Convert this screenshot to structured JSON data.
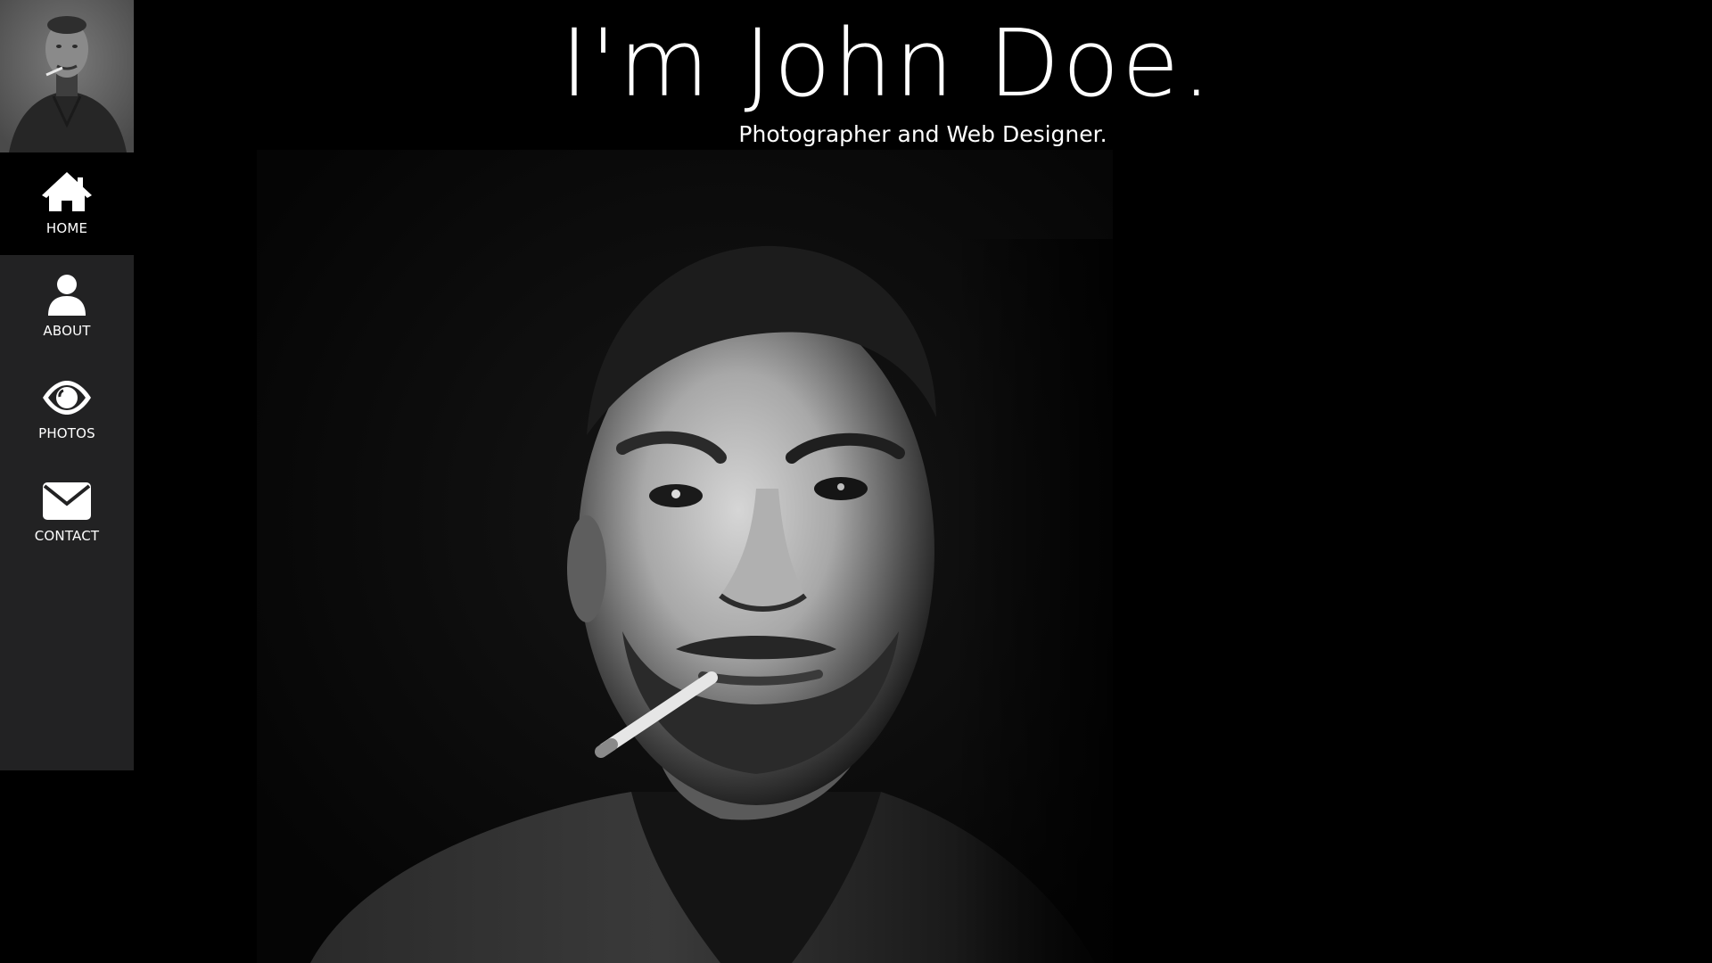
{
  "hero": {
    "title": "I'm John Doe.",
    "subtitle": "Photographer and Web Designer."
  },
  "sidebar": {
    "items": [
      {
        "label": "HOME",
        "icon": "home-icon",
        "active": true
      },
      {
        "label": "ABOUT",
        "icon": "user-icon",
        "active": false
      },
      {
        "label": "PHOTOS",
        "icon": "eye-icon",
        "active": false
      },
      {
        "label": "CONTACT",
        "icon": "envelope-icon",
        "active": false
      }
    ]
  },
  "colors": {
    "background": "#000000",
    "sidebar": "#222223",
    "active_item": "#000000",
    "text": "#ffffff"
  }
}
